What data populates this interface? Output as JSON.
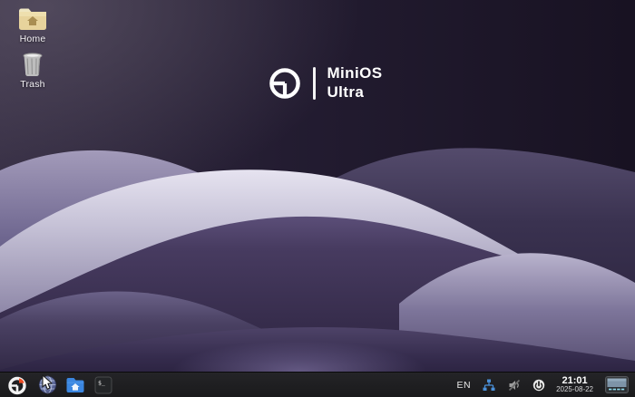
{
  "desktop": {
    "icons": [
      {
        "name": "home",
        "label": "Home",
        "icon": "home-folder-icon"
      },
      {
        "name": "trash",
        "label": "Trash",
        "icon": "trash-icon"
      }
    ],
    "branding": {
      "line1": "MiniOS",
      "line2": "Ultra",
      "logo": "minios-pie-logo"
    }
  },
  "taskbar": {
    "launchers": [
      {
        "name": "start-menu",
        "icon": "minios-menu-icon"
      },
      {
        "name": "web-browser",
        "icon": "globe-icon"
      },
      {
        "name": "file-manager",
        "icon": "folder-home-icon"
      },
      {
        "name": "terminal",
        "icon": "terminal-icon"
      }
    ],
    "terminal_glyph": "$_",
    "tray": {
      "keyboard_layout": "EN",
      "icons": [
        "network-icon",
        "volume-muted-icon",
        "power-icon"
      ],
      "clock_time": "21:01",
      "clock_date": "2025-08-22",
      "show_desktop": "show-desktop-icon"
    }
  },
  "colors": {
    "wallpaper_base": "#241d33",
    "taskbar_bg": "#1d1d1f",
    "accent_blue": "#4a90d9",
    "logo_orange": "#ee4b22",
    "folder_blue": "#3b86e0",
    "lavender_wave": "#c5c1d6"
  }
}
